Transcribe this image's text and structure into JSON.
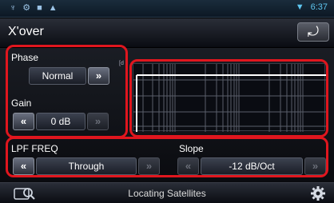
{
  "status": {
    "time": "6:37"
  },
  "header": {
    "title": "X'over"
  },
  "phase": {
    "label": "Phase",
    "value": "Normal"
  },
  "gain": {
    "label": "Gain",
    "value": "0 dB"
  },
  "lpf": {
    "label": "LPF FREQ",
    "value": "Through"
  },
  "slope": {
    "label": "Slope",
    "value": "-12 dB/Oct"
  },
  "footer": {
    "text": "Locating Satellites"
  },
  "colors": {
    "highlight": "#e0161e",
    "accent": "#5ec6f0"
  }
}
